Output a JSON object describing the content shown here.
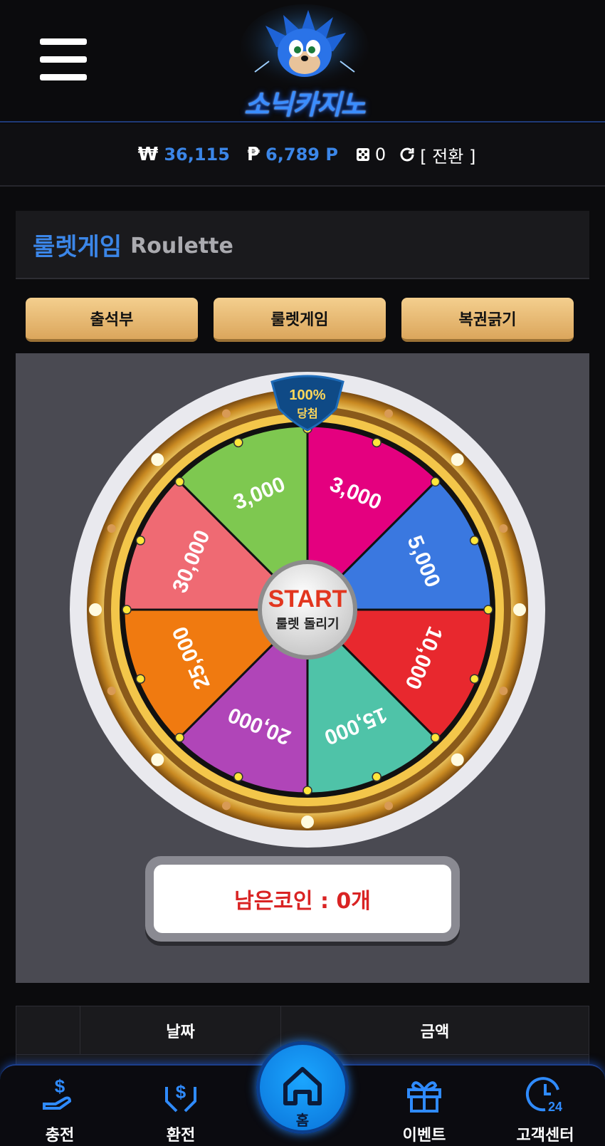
{
  "header": {
    "menu_icon": "hamburger-menu-icon",
    "logo_text": "소닉카지노"
  },
  "balance": {
    "won_symbol": "₩",
    "won_value": "36,115",
    "point_symbol": "₱",
    "point_value": "6,789 P",
    "dice_count": "0",
    "convert_label": "[ 전환 ]"
  },
  "title": {
    "ko": "룰렛게임",
    "en": "Roulette"
  },
  "tabs": [
    {
      "label": "출석부"
    },
    {
      "label": "룰렛게임"
    },
    {
      "label": "복권긁기"
    }
  ],
  "wheel": {
    "badge_top": "100%",
    "badge_bottom": "당첨",
    "start_label": "START",
    "start_sub": "룰렛 돌리기",
    "segments": [
      {
        "label": "3,000",
        "color": "#e4007f"
      },
      {
        "label": "5,000",
        "color": "#3a78e0"
      },
      {
        "label": "10,000",
        "color": "#e8282e"
      },
      {
        "label": "15,000",
        "color": "#4fc3a8"
      },
      {
        "label": "20,000",
        "color": "#b045b8"
      },
      {
        "label": "25,000",
        "color": "#f07a10"
      },
      {
        "label": "30,000",
        "color": "#ef6a73"
      },
      {
        "label": "3,000",
        "color": "#7ec850"
      }
    ]
  },
  "coins": {
    "label": "남은코인 : 0개"
  },
  "history": {
    "headers": [
      "",
      "날짜",
      "금액"
    ]
  },
  "nav": {
    "items": [
      {
        "label": "충전",
        "icon": "deposit-icon"
      },
      {
        "label": "환전",
        "icon": "withdraw-icon"
      },
      {
        "label": "홈",
        "icon": "home-icon"
      },
      {
        "label": "이벤트",
        "icon": "gift-icon"
      },
      {
        "label": "고객센터",
        "icon": "support-24-icon"
      }
    ]
  },
  "colors": {
    "accent_blue": "#3b86e8",
    "gold_tab": "#e6b870",
    "coin_red": "#d92323"
  }
}
